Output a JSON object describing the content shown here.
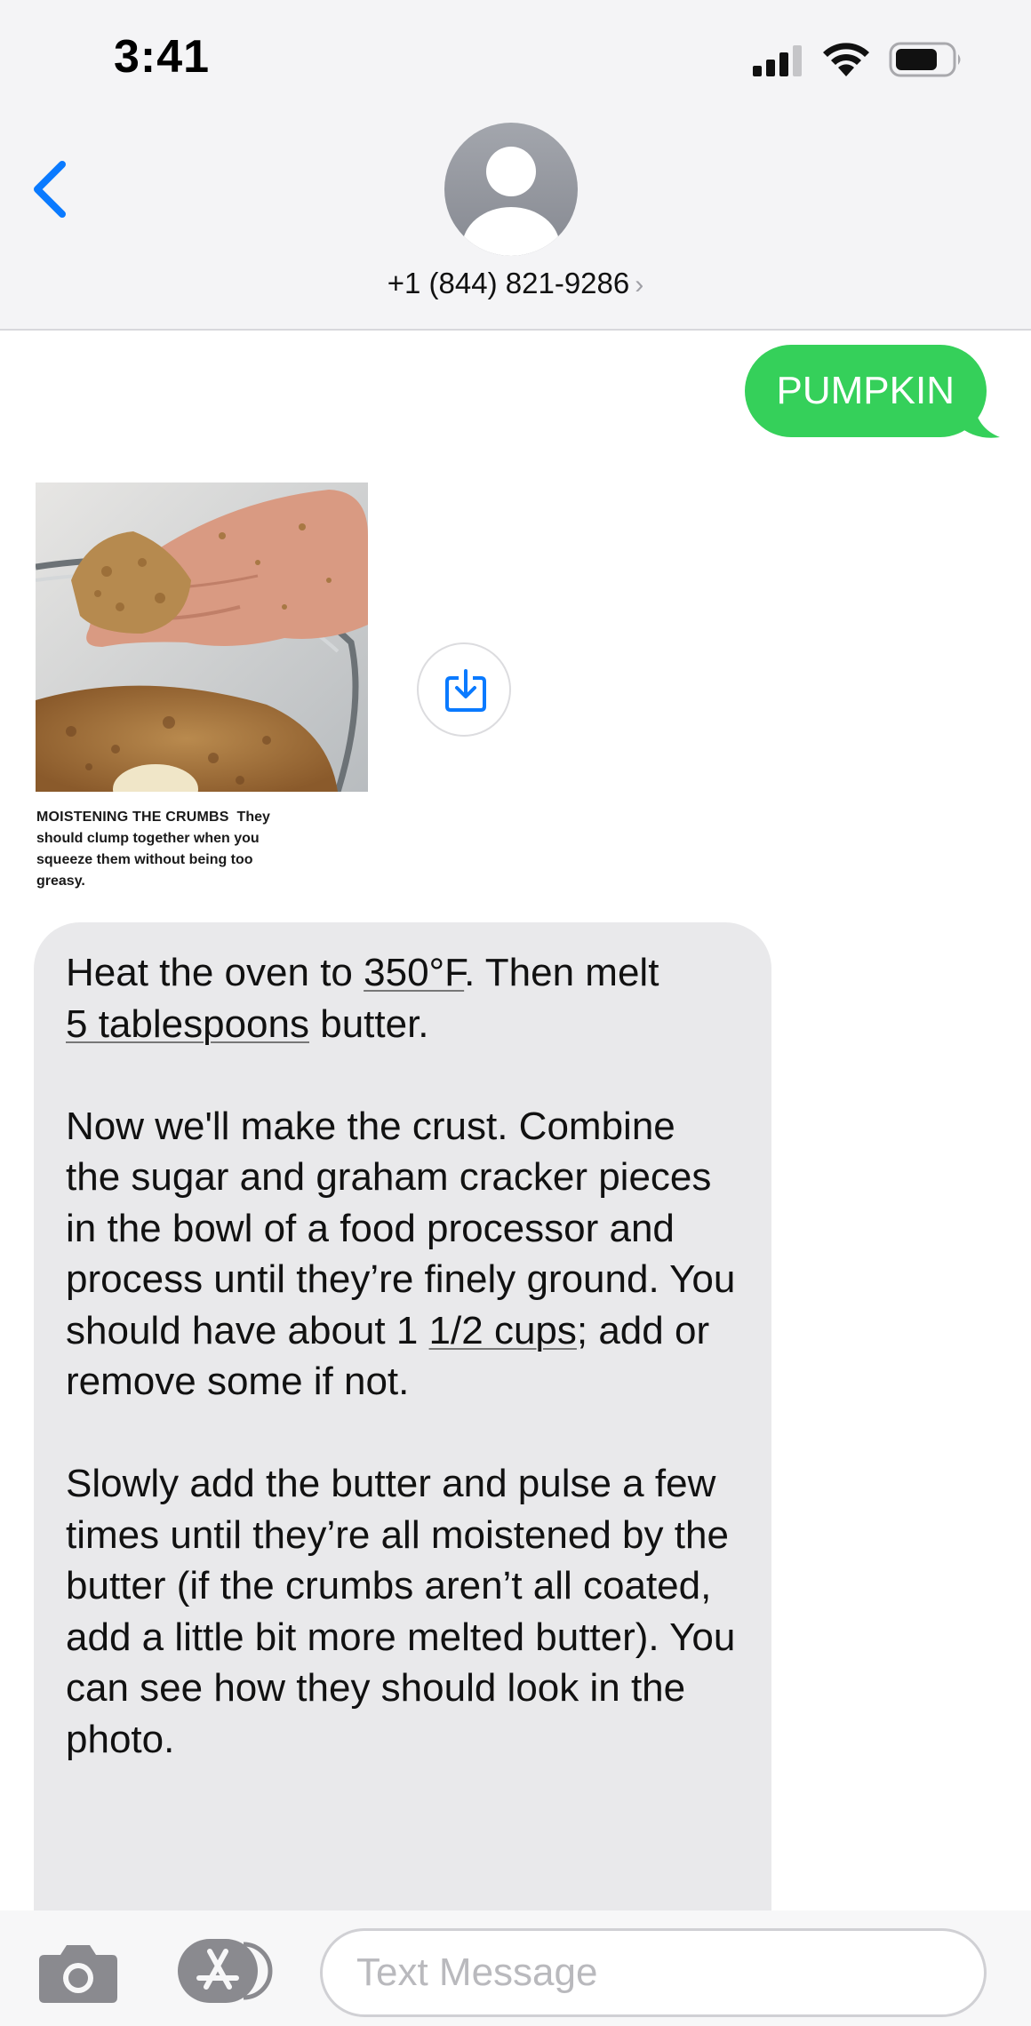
{
  "status_bar": {
    "time": "3:41"
  },
  "header": {
    "contact_name": "+1 (844) 821-9286",
    "chevron": "›"
  },
  "messages": {
    "outgoing": {
      "text": "PUMPKIN",
      "color": "#35d05a"
    },
    "photo": {
      "caption_heading": "MOISTENING THE CRUMBS",
      "caption_body": "They should clump together when you squeeze them without being too greasy."
    },
    "incoming": {
      "p1": {
        "t1": "Heat the oven to ",
        "link1": "350°F",
        "t2": ". Then melt ",
        "link2": "5 tablespoons",
        "t3": " butter."
      },
      "p2": {
        "t1": "Now we'll make the crust. Combine the sugar and graham cracker pieces in the bowl of a food processor and process until they’re finely ground. You should have about 1 ",
        "link1": "1/2 cups",
        "t2": "; add or remove some if not."
      },
      "p3": {
        "t1": "Slowly add the butter and pulse a few times until they’re all moistened by the butter (if the crumbs aren’t all coated, add a little bit more melted butter). You can see how they should look in the photo."
      }
    }
  },
  "compose": {
    "placeholder": "Text Message"
  },
  "icons": {
    "back": "chevron-left-icon",
    "save": "save-to-download-icon",
    "camera": "camera-icon",
    "app_store": "app-store-icon"
  },
  "colors": {
    "accent": "#0a7aff",
    "incoming_bubble": "#e9e9eb"
  }
}
